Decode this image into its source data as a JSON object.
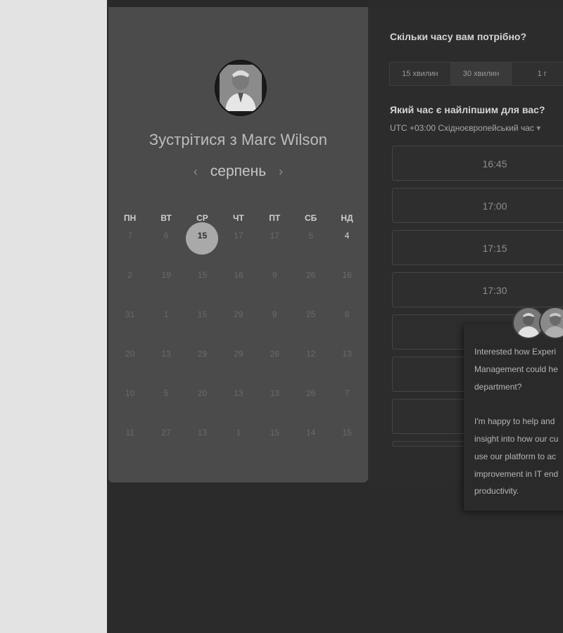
{
  "booking": {
    "title": "Зустрітися з Marc Wilson",
    "month": "серпень",
    "weekdays": [
      "ПН",
      "ВТ",
      "СР",
      "ЧТ",
      "ПТ",
      "СБ",
      "НД"
    ],
    "weeks": [
      [
        "7",
        "6",
        "15",
        "17",
        "17",
        "5",
        "4"
      ],
      [
        "2",
        "19",
        "15",
        "16",
        "9",
        "26",
        "16"
      ],
      [
        "31",
        "1",
        "15",
        "29",
        "9",
        "25",
        "8"
      ],
      [
        "20",
        "13",
        "29",
        "29",
        "26",
        "12",
        "13"
      ],
      [
        "10",
        "5",
        "20",
        "13",
        "13",
        "26",
        "7"
      ],
      [
        "11",
        "27",
        "13",
        "1",
        "15",
        "14",
        "15"
      ]
    ]
  },
  "duration": {
    "question": "Скільки часу вам потрібно?",
    "options": [
      "15 хвилин",
      "30 хвилин",
      "1 г"
    ]
  },
  "time": {
    "question": "Який час є найліпшим для вас?",
    "timezone": "UTC +03:00 Східноєвропейський час",
    "slots": [
      "16:45",
      "17:00",
      "17:15",
      "17:30",
      "",
      "",
      ""
    ]
  },
  "chat": {
    "line1": "Interested how Experi",
    "line2": "Management could he",
    "line3": "department?",
    "line4": "I'm happy to help and",
    "line5": "insight into how our cu",
    "line6": "use our platform to ac",
    "line7": "improvement in IT end",
    "line8": "productivity."
  }
}
